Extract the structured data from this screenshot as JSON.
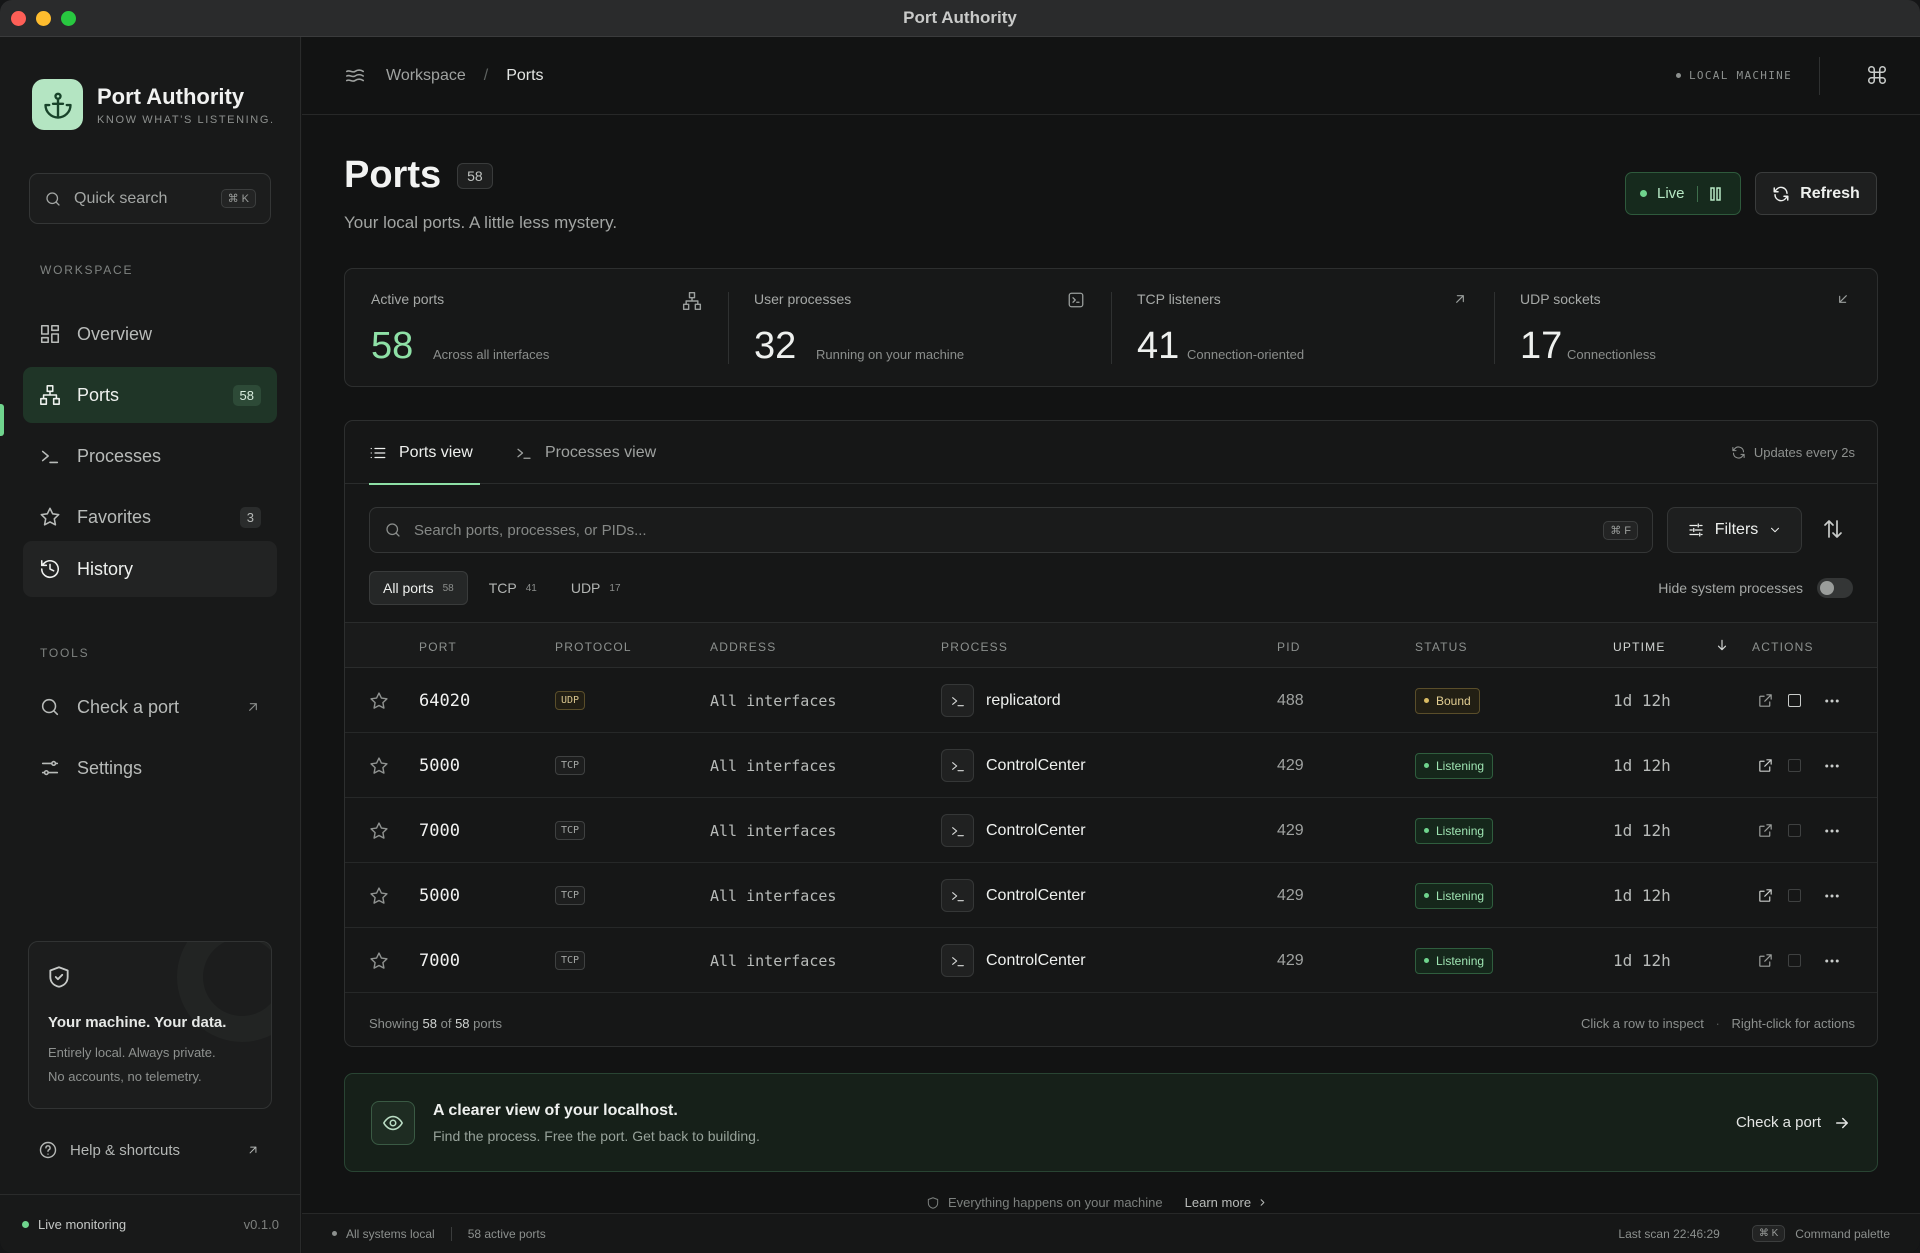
{
  "window": {
    "title": "Port Authority"
  },
  "brand": {
    "name": "Port Authority",
    "tagline": "KNOW WHAT'S LISTENING."
  },
  "quick_search": {
    "label": "Quick search",
    "shortcut": "⌘ K"
  },
  "sidebar": {
    "workspace_label": "WORKSPACE",
    "items": [
      {
        "label": "Overview",
        "icon": "grid-icon"
      },
      {
        "label": "Ports",
        "icon": "network-icon",
        "badge": "58",
        "active": true
      },
      {
        "label": "Processes",
        "icon": "terminal-icon"
      },
      {
        "label": "Favorites",
        "icon": "star-icon",
        "badge": "3"
      },
      {
        "label": "History",
        "icon": "history-icon"
      }
    ],
    "tools_label": "TOOLS",
    "tools": [
      {
        "label": "Check a port",
        "icon": "search-icon"
      },
      {
        "label": "Settings",
        "icon": "sliders-icon"
      }
    ],
    "privacy": {
      "title": "Your machine. Your data.",
      "line1": "Entirely local. Always private.",
      "line2": "No accounts, no telemetry."
    },
    "help": "Help & shortcuts",
    "footer": {
      "status": "Live monitoring",
      "version": "v0.1.0"
    }
  },
  "topbar": {
    "breadcrumb": [
      "Workspace",
      "Ports"
    ],
    "machine": "LOCAL MACHINE"
  },
  "page": {
    "title": "Ports",
    "count": "58",
    "subtitle": "Your local ports. A little less mystery.",
    "live_label": "Live",
    "refresh_label": "Refresh"
  },
  "stats": [
    {
      "label": "Active ports",
      "value": "58",
      "note": "Across all interfaces"
    },
    {
      "label": "User processes",
      "value": "32",
      "note": "Running on your machine"
    },
    {
      "label": "TCP listeners",
      "value": "41",
      "note": "Connection-oriented"
    },
    {
      "label": "UDP sockets",
      "value": "17",
      "note": "Connectionless"
    }
  ],
  "tabs": [
    {
      "label": "Ports view",
      "active": true
    },
    {
      "label": "Processes view"
    }
  ],
  "updates": "Updates every 2s",
  "search": {
    "placeholder": "Search ports, processes, or PIDs...",
    "shortcut": "⌘ F"
  },
  "filters_label": "Filters",
  "chips": [
    {
      "label": "All ports",
      "count": "58",
      "active": true
    },
    {
      "label": "TCP",
      "count": "41"
    },
    {
      "label": "UDP",
      "count": "17"
    }
  ],
  "hide_system": "Hide system processes",
  "table": {
    "headers": {
      "port": "PORT",
      "protocol": "PROTOCOL",
      "address": "ADDRESS",
      "process": "PROCESS",
      "pid": "PID",
      "status": "STATUS",
      "uptime": "UPTIME",
      "actions": "ACTIONS"
    },
    "rows": [
      {
        "port": "64020",
        "protocol": "UDP",
        "address": "All interfaces",
        "process": "replicatord",
        "pid": "488",
        "status": "Bound",
        "uptime": "1d 12h"
      },
      {
        "port": "5000",
        "protocol": "TCP",
        "address": "All interfaces",
        "process": "ControlCenter",
        "pid": "429",
        "status": "Listening",
        "uptime": "1d 12h"
      },
      {
        "port": "7000",
        "protocol": "TCP",
        "address": "All interfaces",
        "process": "ControlCenter",
        "pid": "429",
        "status": "Listening",
        "uptime": "1d 12h"
      },
      {
        "port": "5000",
        "protocol": "TCP",
        "address": "All interfaces",
        "process": "ControlCenter",
        "pid": "429",
        "status": "Listening",
        "uptime": "1d 12h"
      },
      {
        "port": "7000",
        "protocol": "TCP",
        "address": "All interfaces",
        "process": "ControlCenter",
        "pid": "429",
        "status": "Listening",
        "uptime": "1d 12h"
      }
    ],
    "footer": {
      "showing": "Showing",
      "shown": "58",
      "of": "of",
      "total": "58",
      "suffix": "ports",
      "hint_click": "Click a row to inspect",
      "hint_right": "Right-click for actions"
    }
  },
  "promo": {
    "title": "A clearer view of your localhost.",
    "subtitle": "Find the process. Free the port. Get back to building.",
    "cta": "Check a port"
  },
  "peek": {
    "text": "Everything happens on your machine",
    "link": "Learn more"
  },
  "statusbar": {
    "systems": "All systems local",
    "active_ports": "58 active ports",
    "last_scan": "Last scan 22:46:29",
    "shortcut": "⌘ K",
    "command": "Command palette"
  },
  "colors": {
    "accent": "#8ee0a6",
    "active_nav": "#1f3527",
    "bound": "#e3cf93"
  }
}
